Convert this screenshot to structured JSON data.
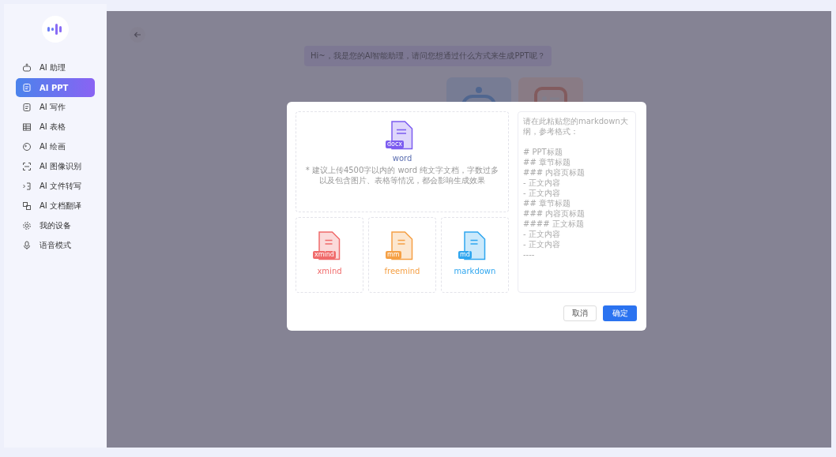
{
  "sidebar": {
    "items": [
      {
        "label": "AI 助理",
        "selected": false
      },
      {
        "label": "AI PPT",
        "selected": true
      },
      {
        "label": "AI 写作",
        "selected": false
      },
      {
        "label": "AI 表格",
        "selected": false
      },
      {
        "label": "AI 绘画",
        "selected": false
      },
      {
        "label": "AI 图像识别",
        "selected": false
      },
      {
        "label": "AI 文件转写",
        "selected": false
      },
      {
        "label": "AI 文档翻译",
        "selected": false
      },
      {
        "label": "我的设备",
        "selected": false
      },
      {
        "label": "语音模式",
        "selected": false
      }
    ]
  },
  "chat": {
    "greeting": "Hi~，我是您的AI智能助理，请问您想通过什么方式来生成PPT呢？"
  },
  "dialog": {
    "word": {
      "tag": "docx",
      "label": "word",
      "color": "#7c5cf0",
      "hint": "* 建议上传4500字以内的 word 纯文字文档，字数过多以及包含图片、表格等情况，都会影响生成效果"
    },
    "formats": [
      {
        "tag": "xmind",
        "label": "xmind",
        "color": "#f06b6b"
      },
      {
        "tag": "mm",
        "label": "freemind",
        "color": "#f5a045"
      },
      {
        "tag": "md",
        "label": "markdown",
        "color": "#2fa6ef"
      }
    ],
    "outline": {
      "placeholder": "请在此粘贴您的markdown大纲，参考格式：\n\n# PPT标题\n## 章节标题\n### 内容页标题\n- 正文内容\n- 正文内容\n## 章节标题\n### 内容页标题\n#### 正文标题\n- 正文内容\n- 正文内容\n----"
    },
    "buttons": [
      {
        "label": "取消",
        "kind": "secondary"
      },
      {
        "label": "确定",
        "kind": "primary"
      }
    ]
  }
}
